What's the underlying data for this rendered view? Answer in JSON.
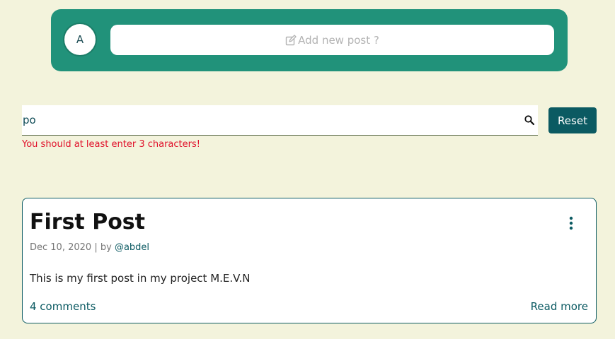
{
  "composer": {
    "avatar_initial": "A",
    "new_post_placeholder": "Add new post ?",
    "edit_icon": "edit-icon"
  },
  "search": {
    "value": "po",
    "icon": "search-icon",
    "reset_label": "Reset",
    "error": "You should at least enter 3 characters!"
  },
  "post": {
    "title": "First Post",
    "date": "Dec 10, 2020",
    "by_label": "| by",
    "author": "@abdel",
    "body": "This is my first post in my project M.E.V.N",
    "comments_link": "4 comments",
    "read_more": "Read more",
    "menu_icon": "kebab-menu-icon"
  },
  "colors": {
    "background": "#f3f3dc",
    "composer": "#21927a",
    "accent": "#0b5a62",
    "error": "#e0102a"
  }
}
